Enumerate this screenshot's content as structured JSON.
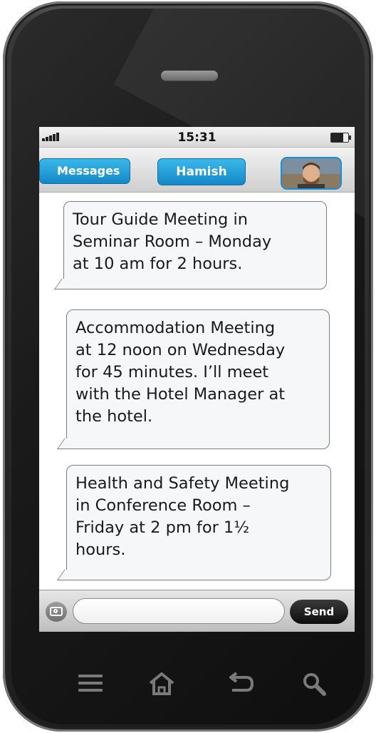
{
  "status_bar": {
    "time": "15:31"
  },
  "nav_bar": {
    "back_label": "Messages",
    "contact_name": "Hamish"
  },
  "messages": [
    {
      "text": "Tour Guide Meeting in\nSeminar Room – Monday\nat 10 am for 2 hours."
    },
    {
      "text": "Accommodation Meeting\nat 12 noon on Wednesday\nfor 45 minutes. I’ll meet\nwith the Hotel Manager at\nthe hotel."
    },
    {
      "text": "Health and Safety Meeting\nin Conference Room –\nFriday at 2 pm for 1½\nhours."
    }
  ],
  "input_bar": {
    "placeholder": "",
    "send_label": "Send"
  },
  "icons": {
    "signal": "signal-icon",
    "battery": "battery-icon",
    "camera": "camera-icon",
    "menu": "menu-icon",
    "home": "home-icon",
    "back": "back-icon",
    "search": "search-icon"
  },
  "colors": {
    "accent": "#1a9ad9",
    "send": "#111111"
  }
}
